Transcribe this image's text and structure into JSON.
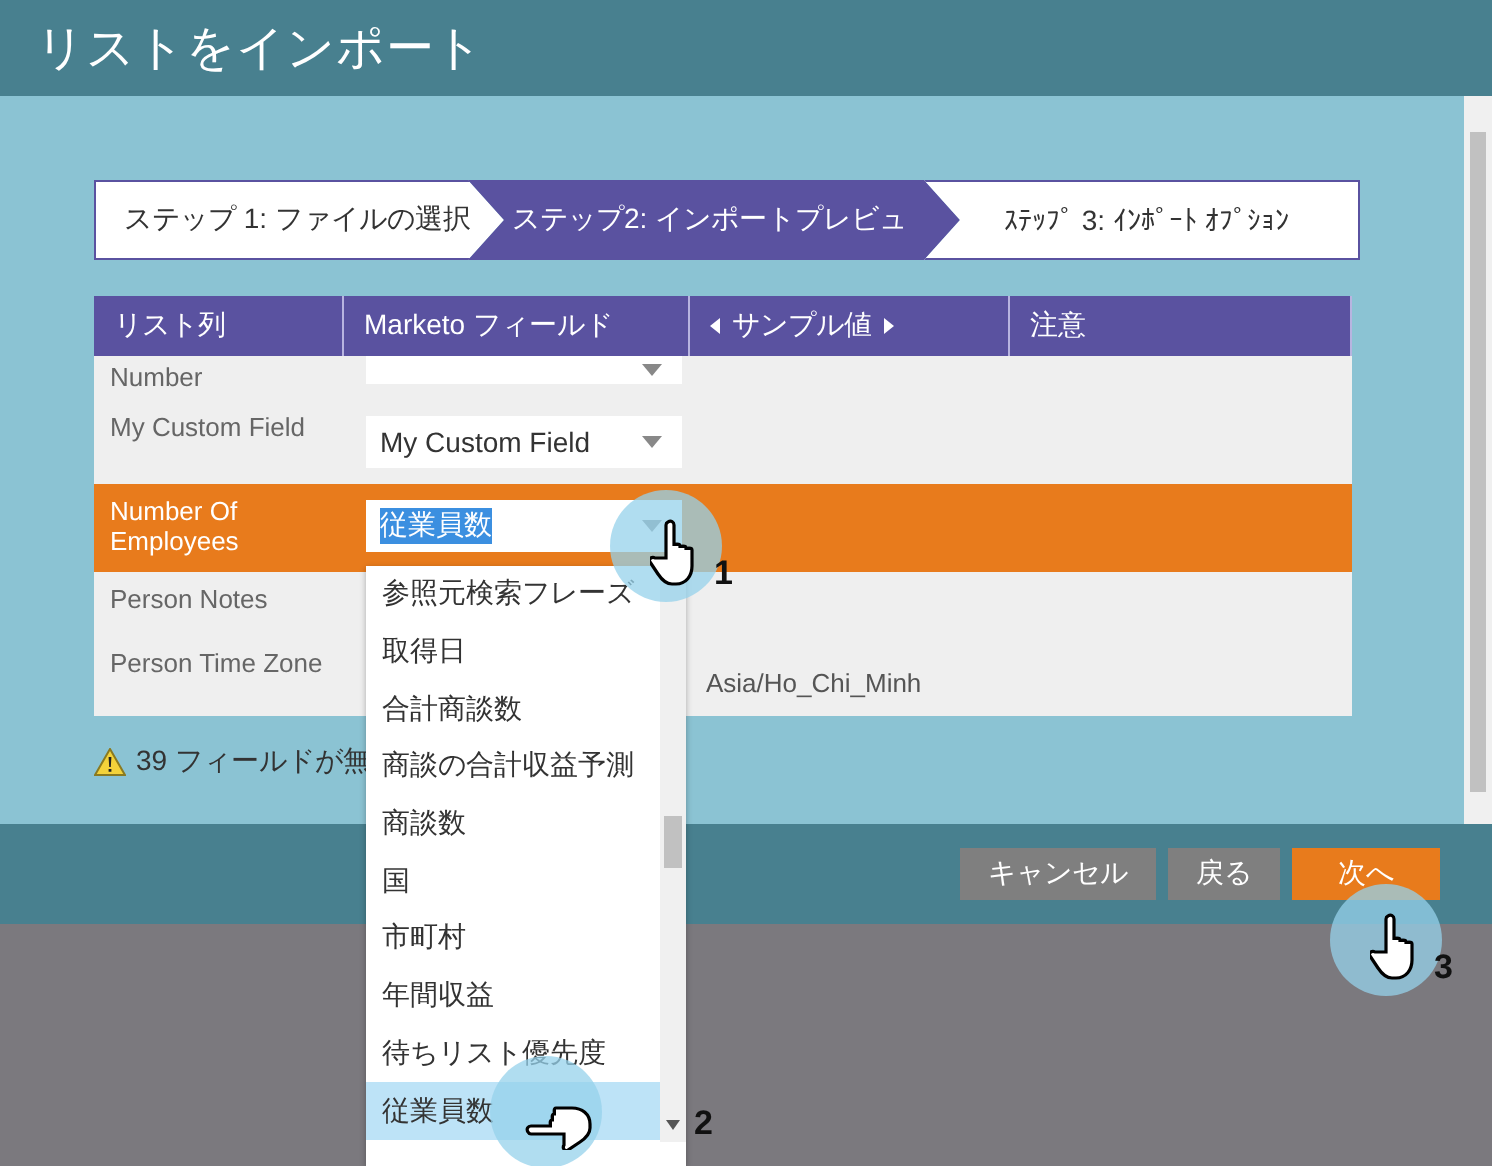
{
  "window": {
    "title": "リストをインポート"
  },
  "steps": [
    {
      "label": "ステップ 1: ファイルの選択",
      "selected": false
    },
    {
      "label": "ステップ2: インポートプレビュ",
      "selected": true
    },
    {
      "label": "ｽﾃｯﾌﾟ 3: ｲﾝﾎﾟｰﾄ ｵﾌﾟｼｮﾝ",
      "selected": false
    }
  ],
  "table": {
    "columns": [
      {
        "label": "リスト列",
        "kind": "plain"
      },
      {
        "label": "Marketo フィールド",
        "kind": "plain"
      },
      {
        "label": "サンプル値",
        "kind": "pager"
      },
      {
        "label": "注意",
        "kind": "plain"
      }
    ],
    "rows": [
      {
        "list_column": "Number",
        "selected": false
      },
      {
        "list_column": "My Custom Field",
        "field": "My Custom Field",
        "selected": false
      },
      {
        "list_column": "Number Of Employees",
        "field": "従業員数",
        "selected": true
      },
      {
        "list_column": "Person Notes",
        "selected": false
      },
      {
        "list_column": "Person Time Zone",
        "sample": "Asia/Ho_Chi_Minh",
        "selected": false
      }
    ]
  },
  "warning": {
    "text": "39 フィールドが無"
  },
  "dropdown": {
    "items": [
      {
        "label": "参照元検索フレーズ",
        "selected": false
      },
      {
        "label": "取得日",
        "selected": false
      },
      {
        "label": "合計商談数",
        "selected": false
      },
      {
        "label": "商談の合計収益予測",
        "selected": false
      },
      {
        "label": "商談数",
        "selected": false
      },
      {
        "label": "国",
        "selected": false
      },
      {
        "label": "市町村",
        "selected": false
      },
      {
        "label": "年間収益",
        "selected": false
      },
      {
        "label": "待ちリスト優先度",
        "selected": false
      },
      {
        "label": "従業員数",
        "selected": true
      }
    ]
  },
  "buttons": [
    {
      "label": "キャンセル",
      "kind": "secondary"
    },
    {
      "label": "戻る",
      "kind": "secondary"
    },
    {
      "label": "次へ",
      "kind": "primary"
    }
  ],
  "markers": [
    {
      "number": "1"
    },
    {
      "number": "2"
    },
    {
      "number": "3"
    }
  ]
}
